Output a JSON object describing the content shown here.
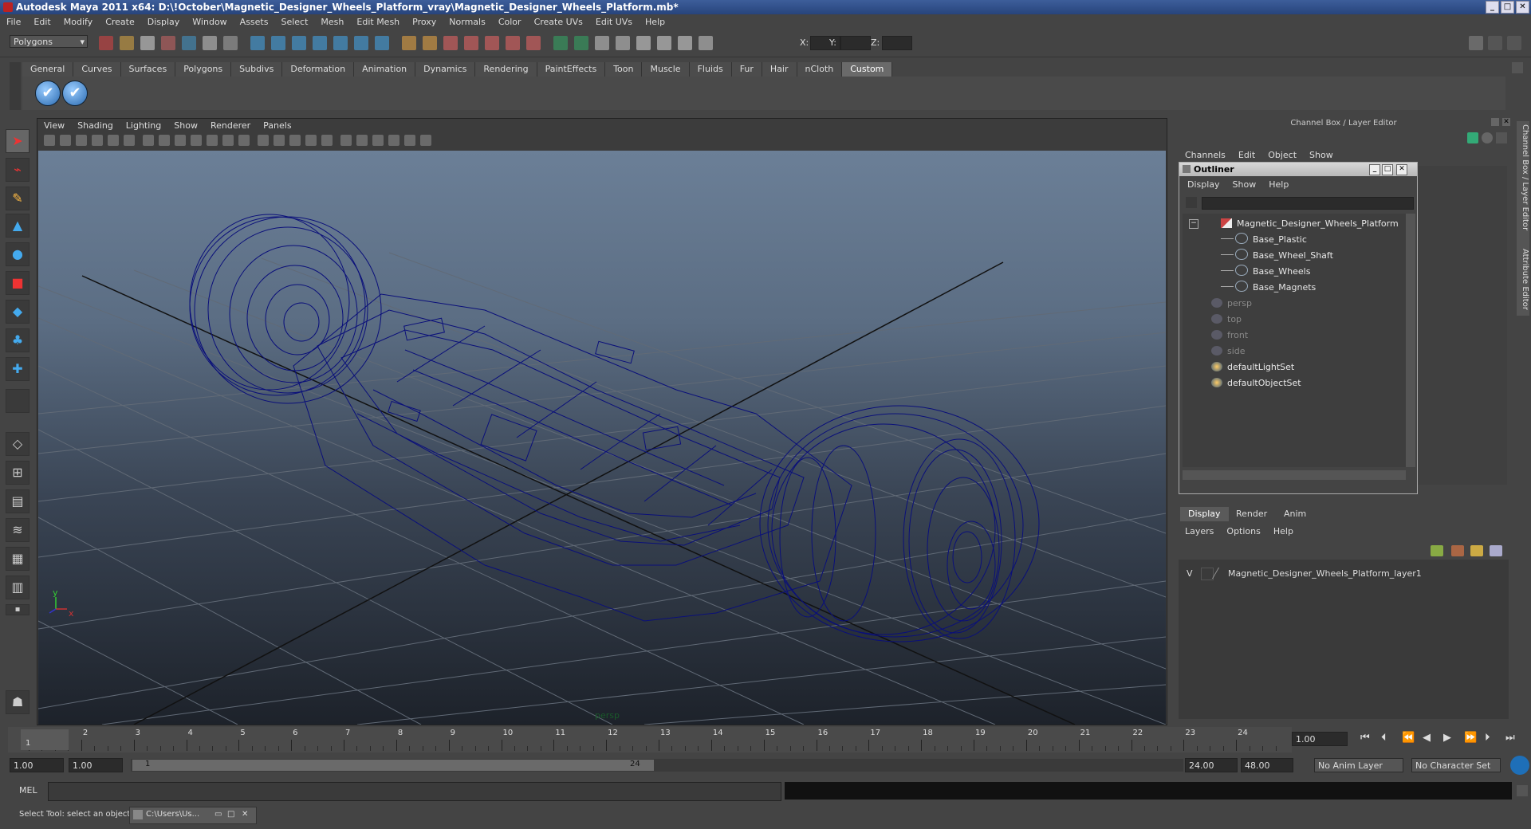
{
  "titlebar": {
    "title": "Autodesk Maya 2011 x64: D:\\!October\\Magnetic_Designer_Wheels_Platform_vray\\Magnetic_Designer_Wheels_Platform.mb*"
  },
  "menu": [
    "File",
    "Edit",
    "Modify",
    "Create",
    "Display",
    "Window",
    "Assets",
    "Select",
    "Mesh",
    "Edit Mesh",
    "Proxy",
    "Normals",
    "Color",
    "Create UVs",
    "Edit UVs",
    "Help"
  ],
  "status_line": {
    "menuset": "Polygons",
    "x_label": "X:",
    "y_label": "Y:",
    "z_label": "Z:"
  },
  "shelf_tabs": [
    "General",
    "Curves",
    "Surfaces",
    "Polygons",
    "Subdivs",
    "Deformation",
    "Animation",
    "Dynamics",
    "Rendering",
    "PaintEffects",
    "Toon",
    "Muscle",
    "Fluids",
    "Fur",
    "Hair",
    "nCloth",
    "Custom"
  ],
  "shelf_active": "Custom",
  "viewport": {
    "menus": [
      "View",
      "Shading",
      "Lighting",
      "Show",
      "Renderer",
      "Panels"
    ],
    "camera_label": "persp",
    "axis_x": "x",
    "axis_y": "y"
  },
  "channel_box": {
    "header": "Channel Box / Layer Editor",
    "menus": [
      "Channels",
      "Edit",
      "Object",
      "Show"
    ]
  },
  "outliner": {
    "title": "Outliner",
    "menus": [
      "Display",
      "Show",
      "Help"
    ],
    "items": [
      {
        "label": "Magnetic_Designer_Wheels_Platform",
        "type": "group",
        "dim": false
      },
      {
        "label": "Base_Plastic",
        "type": "mesh",
        "dim": false
      },
      {
        "label": "Base_Wheel_Shaft",
        "type": "mesh",
        "dim": false
      },
      {
        "label": "Base_Wheels",
        "type": "mesh",
        "dim": false
      },
      {
        "label": "Base_Magnets",
        "type": "mesh",
        "dim": false
      },
      {
        "label": "persp",
        "type": "camera",
        "dim": true
      },
      {
        "label": "top",
        "type": "camera",
        "dim": true
      },
      {
        "label": "front",
        "type": "camera",
        "dim": true
      },
      {
        "label": "side",
        "type": "camera",
        "dim": true
      },
      {
        "label": "defaultLightSet",
        "type": "set",
        "dim": false
      },
      {
        "label": "defaultObjectSet",
        "type": "set",
        "dim": false
      }
    ]
  },
  "layer_editor": {
    "tabs": [
      "Display",
      "Render",
      "Anim"
    ],
    "active_tab": "Display",
    "menus": [
      "Layers",
      "Options",
      "Help"
    ],
    "layer": {
      "visible": "V",
      "name": "Magnetic_Designer_Wheels_Platform_layer1"
    }
  },
  "side_tabs": [
    "Channel Box / Layer Editor",
    "Attribute Editor"
  ],
  "time_slider": {
    "ticks": [
      "1",
      "2",
      "3",
      "4",
      "5",
      "6",
      "7",
      "8",
      "9",
      "10",
      "11",
      "12",
      "13",
      "14",
      "15",
      "16",
      "17",
      "18",
      "19",
      "20",
      "21",
      "22",
      "23",
      "24"
    ],
    "current_time": "1.00",
    "current_frame_marker": "1"
  },
  "range_slider": {
    "start_time": "1.00",
    "playback_start": "1.00",
    "range_start_label": "1",
    "range_end_label": "24",
    "playback_end": "24.00",
    "end_time": "48.00",
    "anim_layer": "No Anim Layer",
    "character_set": "No Character Set"
  },
  "command_line": {
    "label": "MEL"
  },
  "help_line": {
    "text": "Select Tool: select an object",
    "taskbar_item": "C:\\Users\\Us..."
  },
  "colors": {
    "wireframe": "#0a0f7a",
    "title_bar": "#27447c",
    "active_tab": "#6a6a6a"
  }
}
